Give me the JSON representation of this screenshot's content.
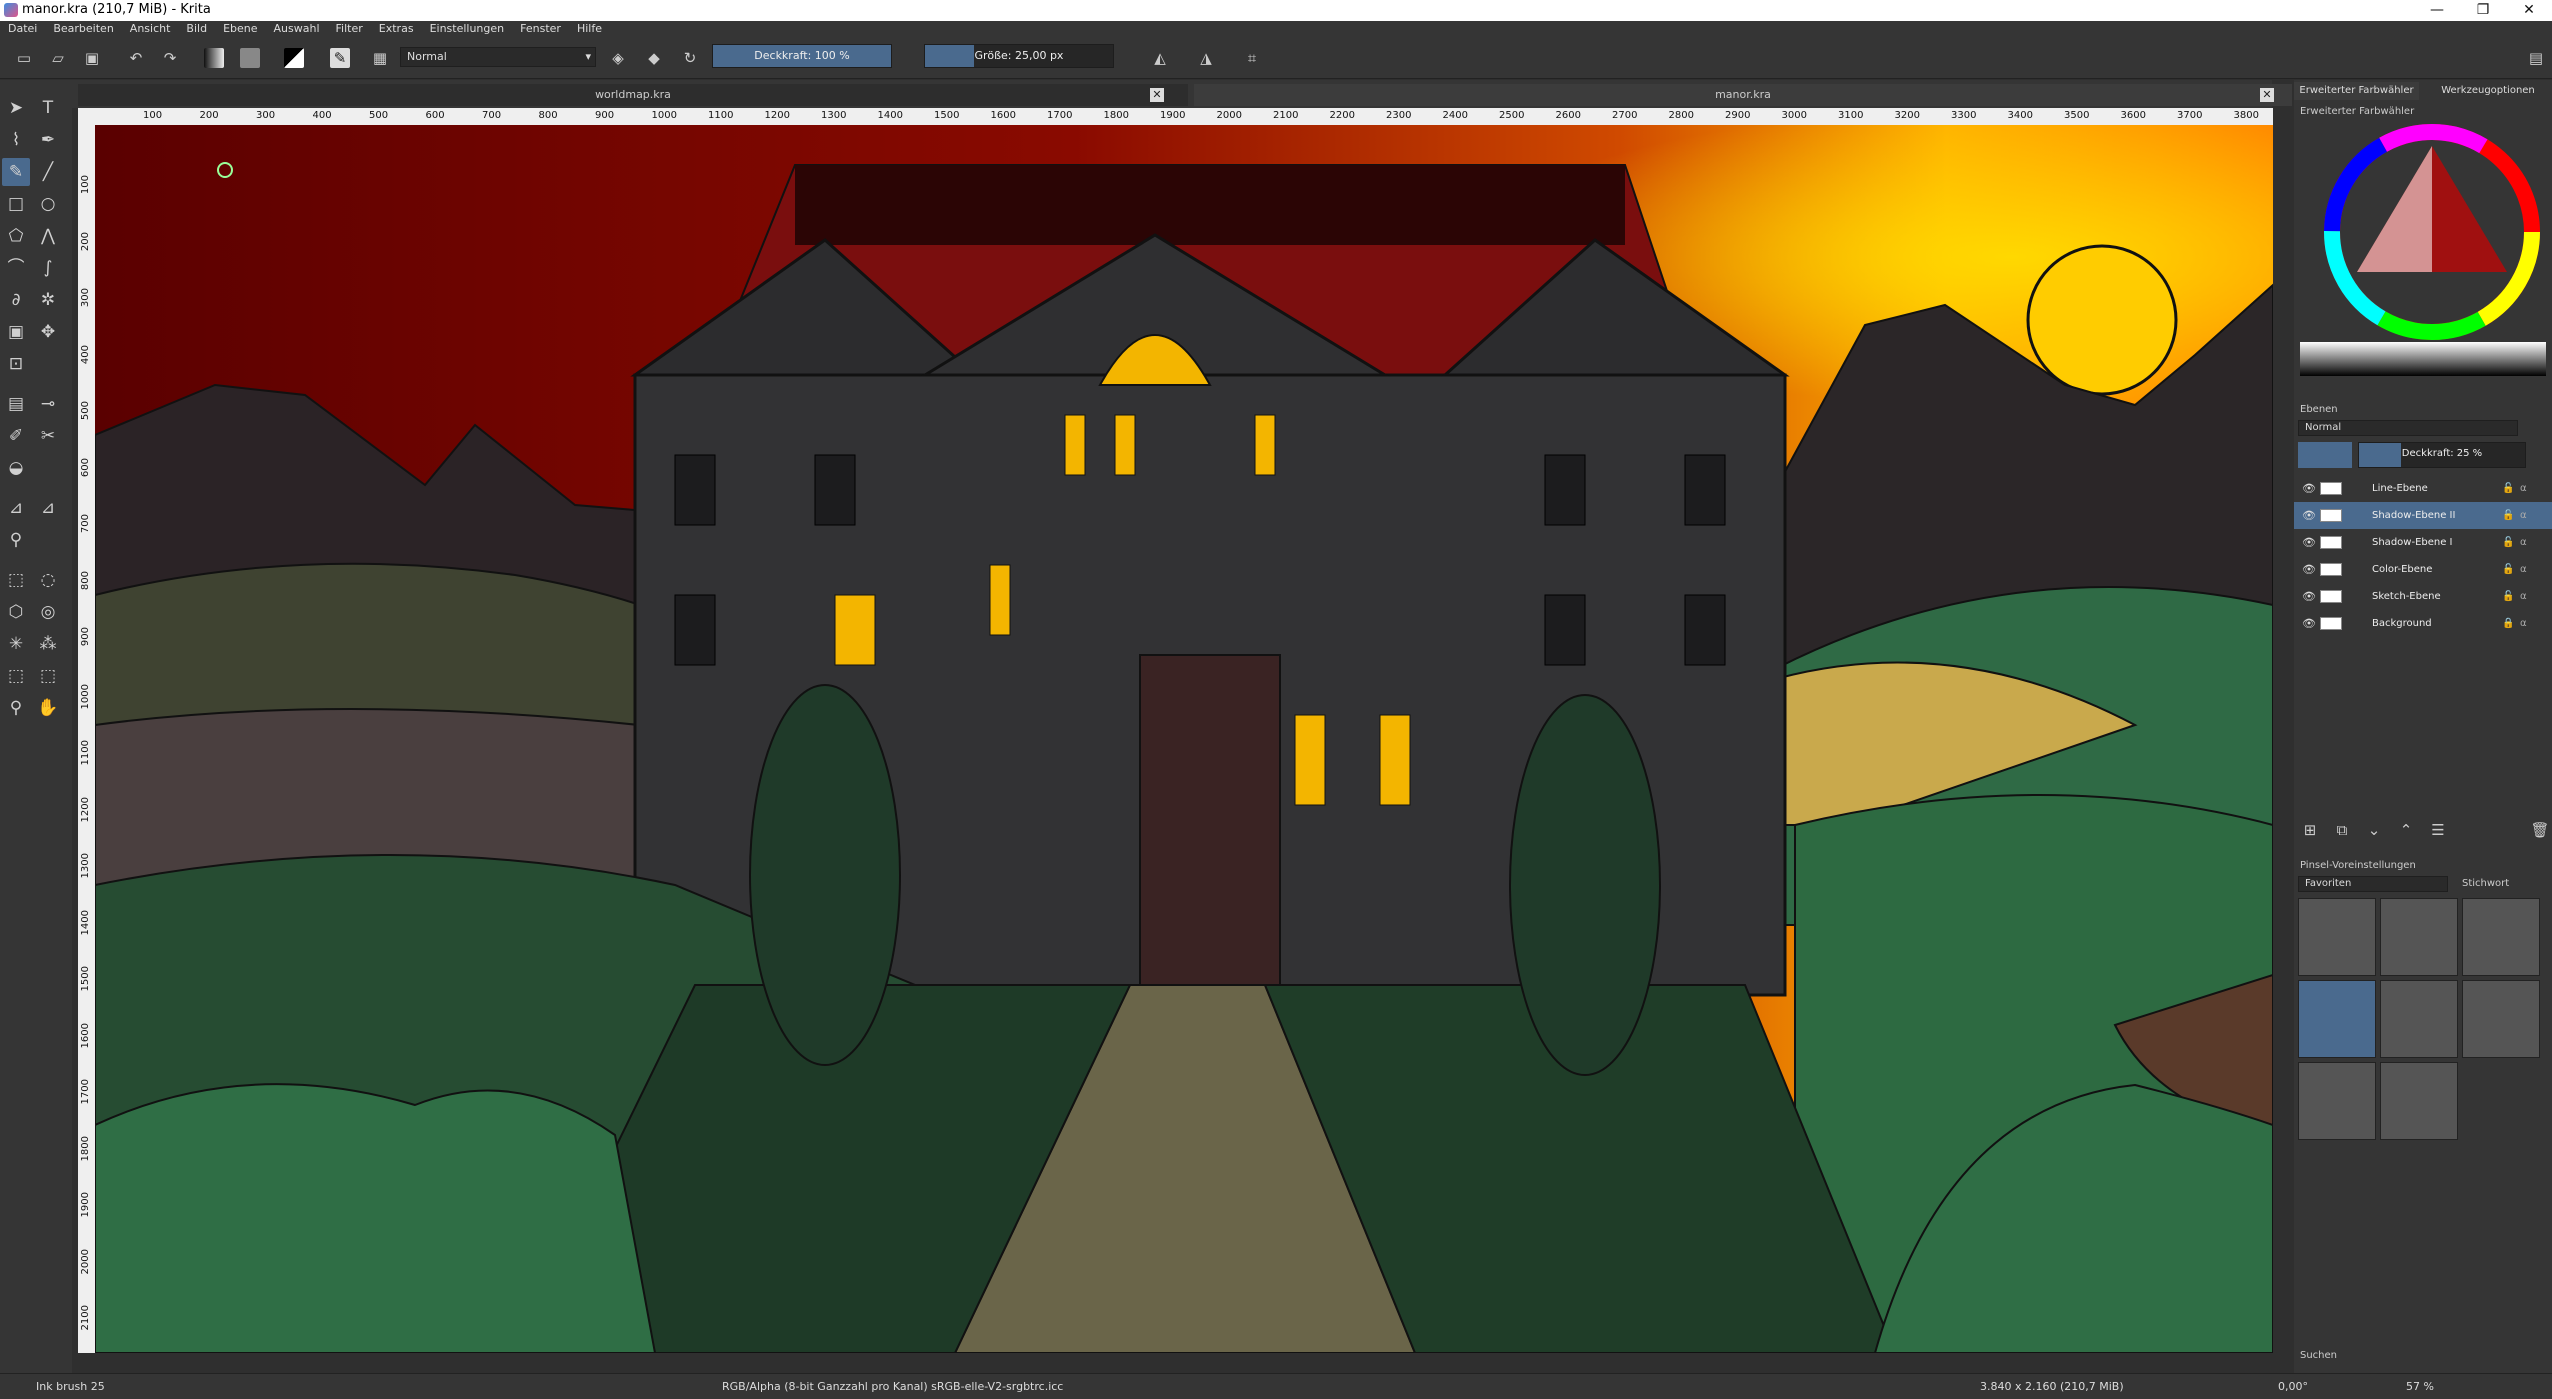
{
  "window": {
    "title": "manor.kra (210,7 MiB)  - Krita",
    "min": "—",
    "max": "❐",
    "close": "✕"
  },
  "menu": [
    "Datei",
    "Bearbeiten",
    "Ansicht",
    "Bild",
    "Ebene",
    "Auswahl",
    "Filter",
    "Extras",
    "Einstellungen",
    "Fenster",
    "Hilfe"
  ],
  "toolbar": {
    "blend_mode": "Normal",
    "opacity": "Deckkraft: 100 %",
    "size": "Größe: 25,00 px"
  },
  "tabs": [
    {
      "label": "worldmap.kra"
    },
    {
      "label": "manor.kra"
    }
  ],
  "ruler": {
    "h": [
      "100",
      "200",
      "300",
      "400",
      "500",
      "600",
      "700",
      "800",
      "900",
      "1000",
      "1100",
      "1200",
      "1300",
      "1400",
      "1500",
      "1600",
      "1700",
      "1800",
      "1900",
      "2000",
      "2100",
      "2200",
      "2300",
      "2400",
      "2500",
      "2600",
      "2700",
      "2800",
      "2900",
      "3000",
      "3100",
      "3200",
      "3300",
      "3400",
      "3500",
      "3600",
      "3700",
      "3800"
    ],
    "v": [
      "100",
      "200",
      "300",
      "400",
      "500",
      "600",
      "700",
      "800",
      "900",
      "1000",
      "1100",
      "1200",
      "1300",
      "1400",
      "1500",
      "1600",
      "1700",
      "1800",
      "1900",
      "2000",
      "2100"
    ]
  },
  "right": {
    "tab_color": "Erweiterter Farbwähler",
    "tab_tools": "Werkzeugoptionen",
    "color_sub": "Erweiterter Farbwähler",
    "layers_title": "Ebenen",
    "layer_blend": "Normal",
    "layer_opacity": "Deckkraft: 25 %",
    "layers": [
      {
        "name": "Line-Ebene"
      },
      {
        "name": "Shadow-Ebene II"
      },
      {
        "name": "Shadow-Ebene I"
      },
      {
        "name": "Color-Ebene"
      },
      {
        "name": "Sketch-Ebene"
      },
      {
        "name": "Background"
      }
    ],
    "brushes_title": "Pinsel-Voreinstellungen",
    "brush_filter": "Favoriten",
    "brush_tag": "Stichwort",
    "search": "Suchen"
  },
  "status": {
    "brush": "Ink brush 25",
    "colorspace": "RGB/Alpha (8-bit Ganzzahl pro Kanal)  sRGB-elle-V2-srgbtrc.icc",
    "dims": "3.840 x 2.160 (210,7 MiB)",
    "angle": "0,00°",
    "zoom": "57 %"
  },
  "colors": {
    "accent": "#4a6a8e",
    "panel": "#353535",
    "sky_top": "#5a0000",
    "sky_sun": "#ffcc00",
    "house": "#2e2e30",
    "window_lit": "#f3b500",
    "grass": "#2e6b42"
  }
}
